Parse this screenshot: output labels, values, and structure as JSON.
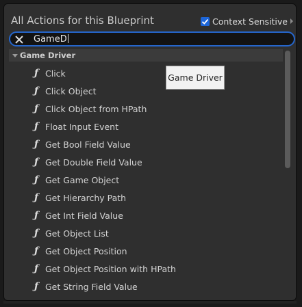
{
  "header": {
    "title": "All Actions for this Blueprint",
    "context_sensitive_label": "Context Sensitive",
    "context_sensitive_checked": true
  },
  "search": {
    "value": "GameD"
  },
  "category": {
    "label": "Game Driver",
    "expanded": true
  },
  "items": [
    {
      "label": "Click",
      "icon": "function-icon"
    },
    {
      "label": "Click Object",
      "icon": "function-icon"
    },
    {
      "label": "Click Object from HPath",
      "icon": "function-icon"
    },
    {
      "label": "Float Input Event",
      "icon": "function-icon"
    },
    {
      "label": "Get Bool Field Value",
      "icon": "function-icon"
    },
    {
      "label": "Get Double Field Value",
      "icon": "function-icon"
    },
    {
      "label": "Get Game Object",
      "icon": "function-icon"
    },
    {
      "label": "Get Hierarchy Path",
      "icon": "function-icon"
    },
    {
      "label": "Get Int Field Value",
      "icon": "function-icon"
    },
    {
      "label": "Get Object List",
      "icon": "function-icon"
    },
    {
      "label": "Get Object Position",
      "icon": "function-icon"
    },
    {
      "label": "Get Object Position with HPath",
      "icon": "function-icon"
    },
    {
      "label": "Get String Field Value",
      "icon": "function-icon"
    }
  ],
  "tooltip": {
    "text": "Game Driver"
  },
  "colors": {
    "accent": "#2566cc",
    "checkbox": "#1d66d9",
    "panel": "#2f2f2f"
  }
}
